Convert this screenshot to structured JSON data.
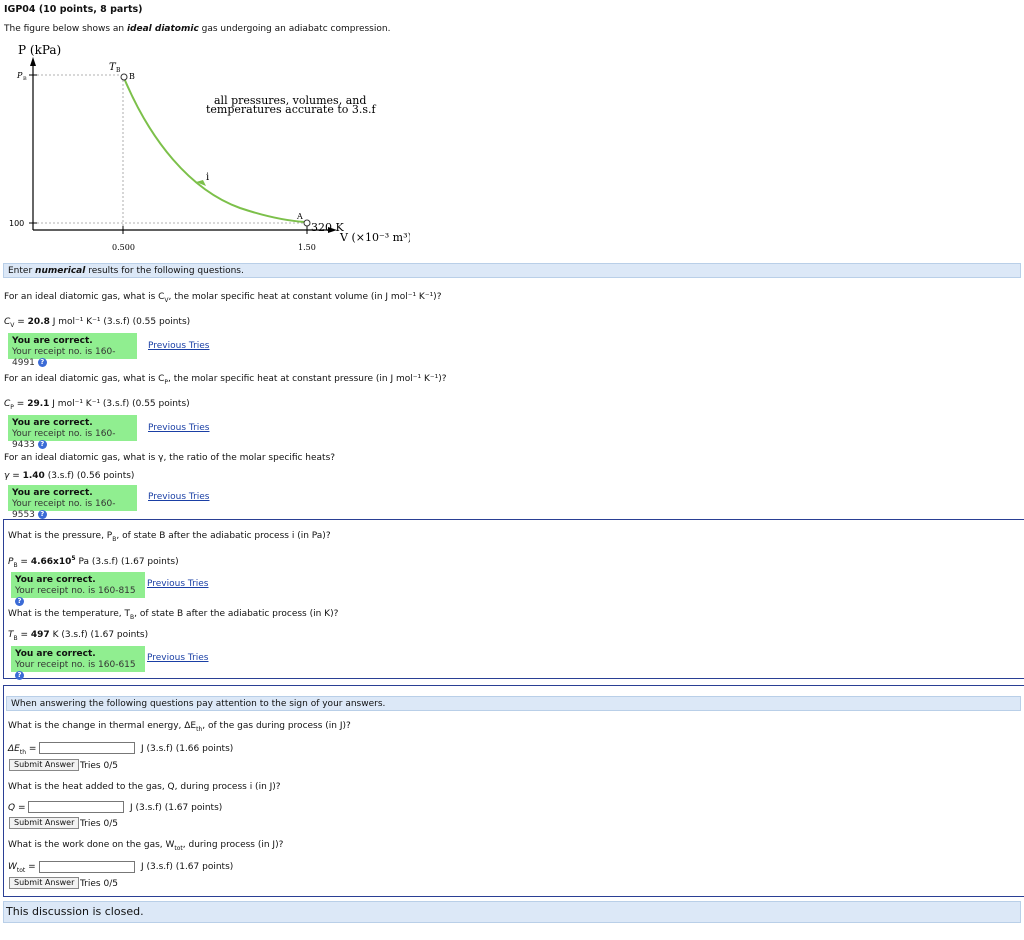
{
  "title": "IGP04 (10 points, 8 parts)",
  "intro": {
    "pre": "The figure below shows an ",
    "bold": "ideal diatomic",
    "post": " gas undergoing an adiabatc compression."
  },
  "graph": {
    "p_axis": "P (kPa)",
    "pb_tick": "P",
    "pb_sub": "B",
    "tb_label": "T",
    "tb_sub": "B",
    "b_label": "B",
    "note_line1": "all pressures, volumes, and",
    "note_line2": "temperatures accurate to 3.s.f",
    "i_label": "i",
    "a_label": "A",
    "temp_a": "320 K",
    "v_axis": "V (×10⁻³ m³)",
    "y_tick_100": "100",
    "x_tick_0500": "0.500",
    "x_tick_150": "1.50"
  },
  "section1_bar": {
    "pre": "Enter ",
    "bold": "numerical",
    "post": " results for the following questions."
  },
  "q1": {
    "question": "For an ideal diatomic gas, what is C",
    "question_sub": "V",
    "question_post": ", the molar specific heat at constant volume (in J mol⁻¹ K⁻¹)?",
    "label": "C",
    "label_sub": "V",
    "value": "20.8",
    "units": "J mol⁻¹ K⁻¹ (3.s.f) (0.55 points)",
    "correct": "You are correct.",
    "receipt": "Your receipt no. is 160-4991",
    "prev": "Previous Tries"
  },
  "q2": {
    "question": "For an ideal diatomic gas, what is C",
    "question_sub": "P",
    "question_post": ", the molar specific heat at constant pressure (in J mol⁻¹ K⁻¹)?",
    "label": "C",
    "label_sub": "P",
    "value": "29.1",
    "units": "J mol⁻¹ K⁻¹ (3.s.f) (0.55 points)",
    "correct": "You are correct.",
    "receipt": "Your receipt no. is 160-9433",
    "prev": "Previous Tries"
  },
  "q3": {
    "question": "For an ideal diatomic gas, what is γ, the ratio of the molar specific heats?",
    "label": "γ",
    "value": "1.40",
    "units": "(3.s.f) (0.56 points)",
    "correct": "You are correct.",
    "receipt": "Your receipt no. is 160-9553",
    "prev": "Previous Tries"
  },
  "q4": {
    "question": "What is the pressure, P",
    "question_sub": "B",
    "question_post": ", of state B after the adiabatic process i (in Pa)?",
    "label": "P",
    "label_sub": "B",
    "value": "4.66x10",
    "value_exp": "5",
    "units": "Pa (3.s.f) (1.67 points)",
    "correct": "You are correct.",
    "receipt": "Your receipt no. is 160-815",
    "prev": "Previous Tries"
  },
  "q5": {
    "question": "What is the temperature, T",
    "question_sub": "B",
    "question_post": ", of state B after the adiabatic process (in K)?",
    "label": "T",
    "label_sub": "B",
    "value": "497",
    "units": "K (3.s.f) (1.67 points)",
    "correct": "You are correct.",
    "receipt": "Your receipt no. is 160-615",
    "prev": "Previous Tries"
  },
  "section2_bar": "When answering the following questions pay attention to the sign of your answers.",
  "q6": {
    "question": "What is the change in thermal energy, ΔE",
    "question_sub": "th",
    "question_post": ", of the gas during process (in J)?",
    "label": "ΔE",
    "label_sub": "th",
    "units": "J (3.s.f) (1.66 points)",
    "submit": "Submit Answer",
    "tries": "Tries 0/5"
  },
  "q7": {
    "question": "What is the heat added to the gas, Q, during process i (in J)?",
    "label": "Q",
    "units": "J (3.s.f) (1.67 points)",
    "submit": "Submit Answer",
    "tries": "Tries 0/5"
  },
  "q8": {
    "question": "What is the work done on the gas, W",
    "question_sub": "tot",
    "question_post": ", during process (in J)?",
    "label": "W",
    "label_sub": "tot",
    "units": "J (3.s.f) (1.67 points)",
    "submit": "Submit Answer",
    "tries": "Tries 0/5"
  },
  "closed": "This discussion is closed."
}
